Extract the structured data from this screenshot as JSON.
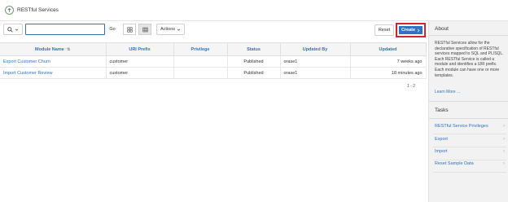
{
  "header": {
    "title": "RESTful Services"
  },
  "toolbar": {
    "search_value": "",
    "go_label": "Go",
    "actions_label": "Actions",
    "reset_label": "Reset",
    "create_label": "Create"
  },
  "table": {
    "columns": [
      "Module Name",
      "URI Prefix",
      "Privilege",
      "Status",
      "Updated By",
      "Updated"
    ],
    "rows": [
      {
        "module": "Export Customer Churn",
        "uri": "customer",
        "privilege": "",
        "status": "Published",
        "updated_by": "orase1",
        "updated": "7 weeks ago"
      },
      {
        "module": "Import Customer Review",
        "uri": "customer",
        "privilege": "",
        "status": "Published",
        "updated_by": "orase1",
        "updated": "18 minutes ago"
      }
    ],
    "pagination": "1 - 2"
  },
  "sidebar": {
    "about_title": "About",
    "about_text": "RESTful Services allow for the declarative specification of RESTful services mapped to SQL and PL/SQL. Each RESTful Service is called a module and identifies a URI prefix. Each module can have one or more templates.",
    "learn_more": "Learn More ...",
    "tasks_title": "Tasks",
    "tasks": [
      "RESTful Service Privileges",
      "Export",
      "Import",
      "Reset Sample Data"
    ]
  },
  "colors": {
    "accent": "#2f72c4",
    "highlight": "#d3232e"
  }
}
